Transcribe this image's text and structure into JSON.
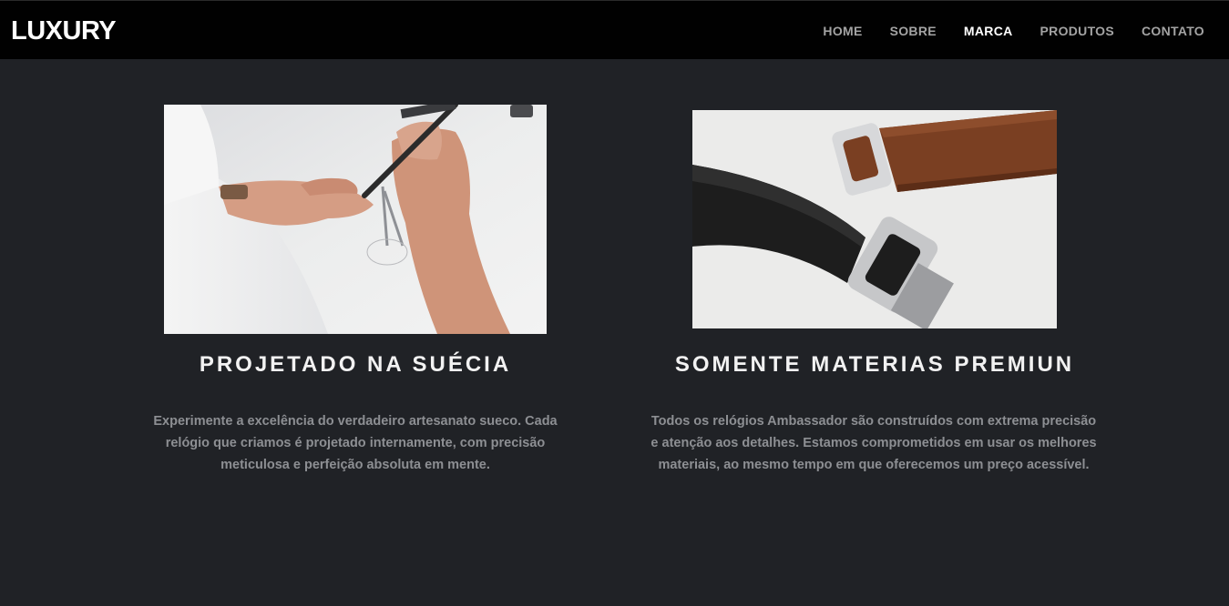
{
  "brand": "LUXURY",
  "nav": {
    "items": [
      {
        "label": "HOME"
      },
      {
        "label": "SOBRE"
      },
      {
        "label": "MARCA"
      },
      {
        "label": "PRODUTOS"
      },
      {
        "label": "CONTATO"
      }
    ],
    "active": "MARCA"
  },
  "features": [
    {
      "image": "designer-drawing-photo",
      "title": "PROJETADO NA SUÉCIA",
      "text": "Experimente a excelência do verdadeiro artesanato sueco. Cada relógio que criamos é projetado internamente, com precisão meticulosa e perfeição absoluta em mente."
    },
    {
      "image": "leather-straps-photo",
      "title": "SOMENTE MATERIAS PREMIUN",
      "text": "Todos os relógios Ambassador são construídos com extrema precisão e atenção aos detalhes. Estamos comprometidos em usar os melhores materiais, ao mesmo tempo em que oferecemos um preço acessível."
    }
  ],
  "colors": {
    "background": "#202226",
    "navbar": "#010101",
    "nav_text": "#a3a3a3",
    "nav_active": "#ffffff",
    "body_text": "#8d8f93"
  }
}
